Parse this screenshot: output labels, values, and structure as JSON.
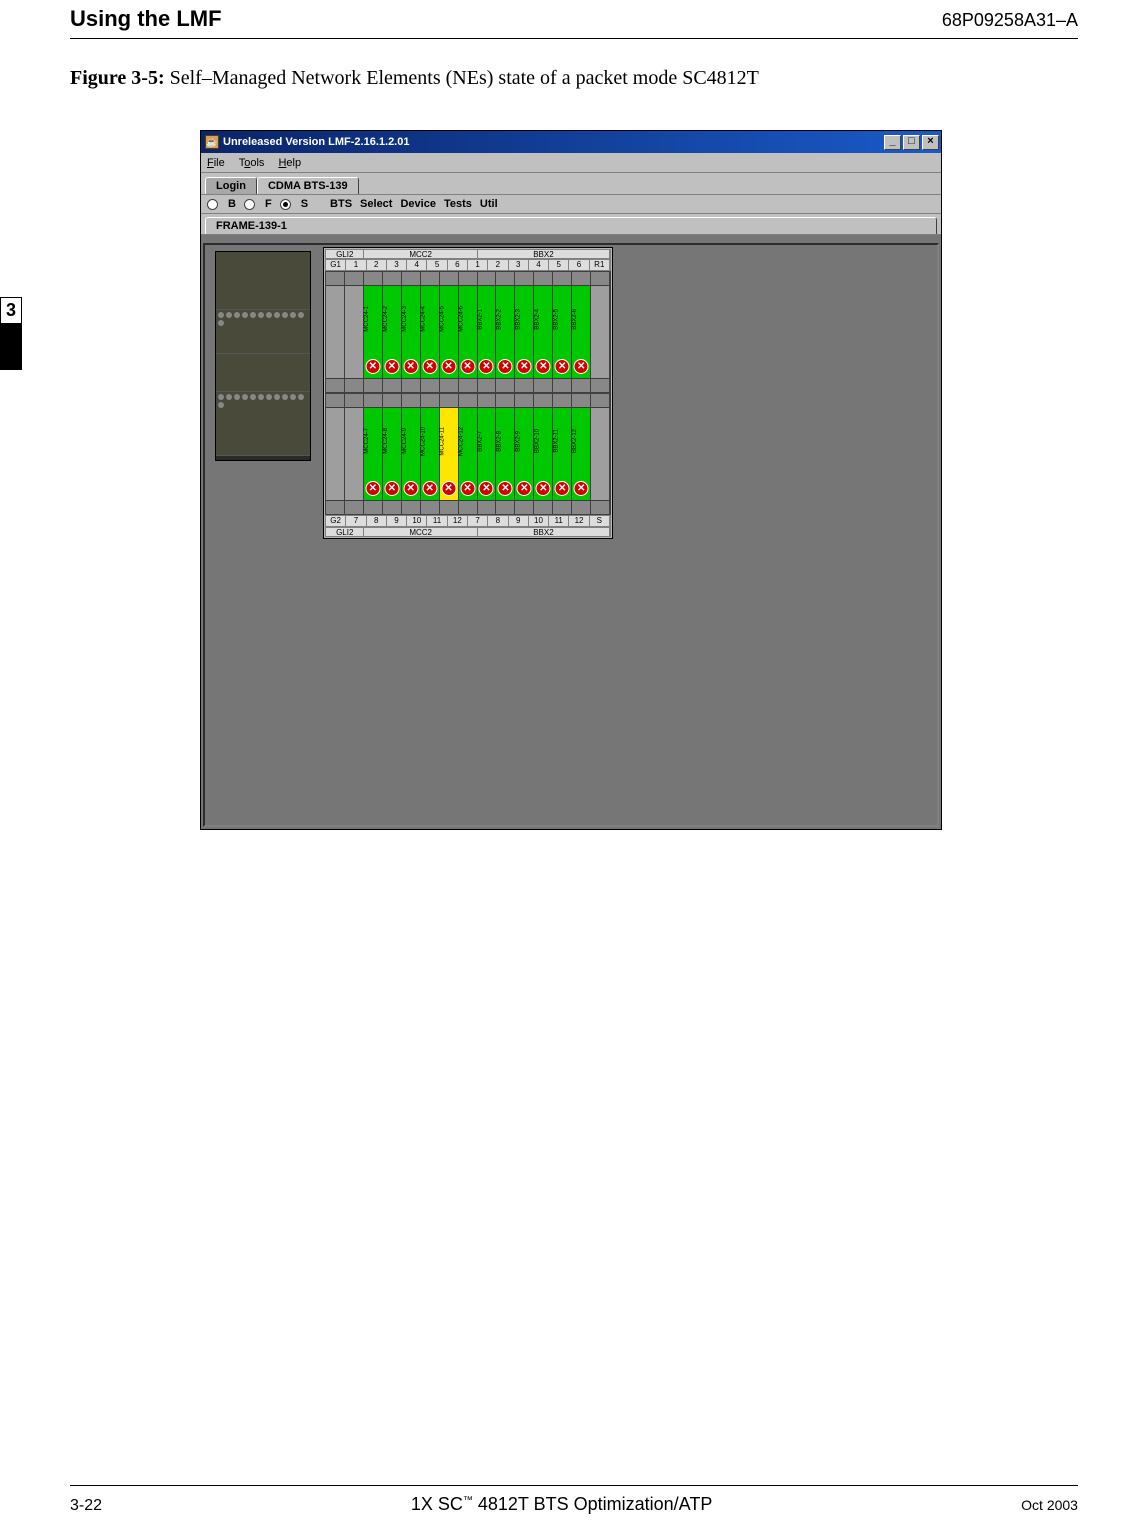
{
  "header": {
    "left": "Using the LMF",
    "right": "68P09258A31–A"
  },
  "figure": {
    "label": "Figure 3-5:",
    "caption": " Self–Managed Network Elements (NEs) state of a packet mode SC4812T"
  },
  "chapter_tab": "3",
  "app": {
    "title": "Unreleased Version LMF-2.16.1.2.01",
    "caption_min": "_",
    "caption_max": "□",
    "caption_close": "×",
    "menu": {
      "file": "File",
      "tools": "Tools",
      "help": "Help"
    },
    "tabs": {
      "login": "Login",
      "cdma": "CDMA BTS-139"
    },
    "toolbar": {
      "b": "B",
      "f": "F",
      "s": "S",
      "bts": "BTS",
      "select": "Select",
      "device": "Device",
      "tests": "Tests",
      "util": "Util"
    },
    "frame_tab": "FRAME-139-1",
    "section_labels_top": {
      "gli": "GLI2",
      "mcc": "MCC2",
      "bbx": "BBX2"
    },
    "section_labels_bottom": {
      "gli": "GLI2",
      "mcc": "MCC2",
      "bbx": "BBX2"
    },
    "top_shelf": {
      "header": [
        "G1",
        "1",
        "2",
        "3",
        "4",
        "5",
        "6",
        "1",
        "2",
        "3",
        "4",
        "5",
        "6",
        "R1"
      ],
      "cards": [
        {
          "color": "gray",
          "label": "",
          "x": false
        },
        {
          "color": "gray",
          "label": "",
          "x": false
        },
        {
          "color": "green",
          "label": "MCC24-1",
          "x": true
        },
        {
          "color": "green",
          "label": "MCC24-2",
          "x": true
        },
        {
          "color": "green",
          "label": "MCC24-3",
          "x": true
        },
        {
          "color": "green",
          "label": "MCC24-4",
          "x": true
        },
        {
          "color": "green",
          "label": "MCC24-5",
          "x": true
        },
        {
          "color": "green",
          "label": "MCC24-6",
          "x": true
        },
        {
          "color": "green",
          "label": "BBX2-1",
          "x": true
        },
        {
          "color": "green",
          "label": "BBX2-2",
          "x": true
        },
        {
          "color": "green",
          "label": "BBX2-3",
          "x": true
        },
        {
          "color": "green",
          "label": "BBX2-4",
          "x": true
        },
        {
          "color": "green",
          "label": "BBX2-5",
          "x": true
        },
        {
          "color": "green",
          "label": "BBX2-6",
          "x": true
        },
        {
          "color": "gray",
          "label": "",
          "x": false
        }
      ]
    },
    "bottom_shelf": {
      "footer": [
        "G2",
        "7",
        "8",
        "9",
        "10",
        "11",
        "12",
        "7",
        "8",
        "9",
        "10",
        "11",
        "12",
        "S"
      ],
      "cards": [
        {
          "color": "gray",
          "label": "",
          "x": false
        },
        {
          "color": "gray",
          "label": "",
          "x": false
        },
        {
          "color": "green",
          "label": "MCC24-7",
          "x": true
        },
        {
          "color": "green",
          "label": "MCC24-8",
          "x": true
        },
        {
          "color": "green",
          "label": "MCC24-9",
          "x": true
        },
        {
          "color": "green",
          "label": "MCC24-10",
          "x": true
        },
        {
          "color": "yellow",
          "label": "MCC24-11",
          "x": true
        },
        {
          "color": "green",
          "label": "MCC24-12",
          "x": true
        },
        {
          "color": "green",
          "label": "BBX2-7",
          "x": true
        },
        {
          "color": "green",
          "label": "BBX2-8",
          "x": true
        },
        {
          "color": "green",
          "label": "BBX2-9",
          "x": true
        },
        {
          "color": "green",
          "label": "BBX2-10",
          "x": true
        },
        {
          "color": "green",
          "label": "BBX2-11",
          "x": true
        },
        {
          "color": "green",
          "label": "BBX2-12",
          "x": true
        },
        {
          "color": "gray",
          "label": "",
          "x": false
        }
      ]
    },
    "x_glyph": "✕"
  },
  "footer": {
    "page_num": "3-22",
    "book_title_pre": "1X SC",
    "book_title_tm": "™",
    "book_title_post": " 4812T BTS Optimization/ATP",
    "date": "Oct 2003"
  }
}
